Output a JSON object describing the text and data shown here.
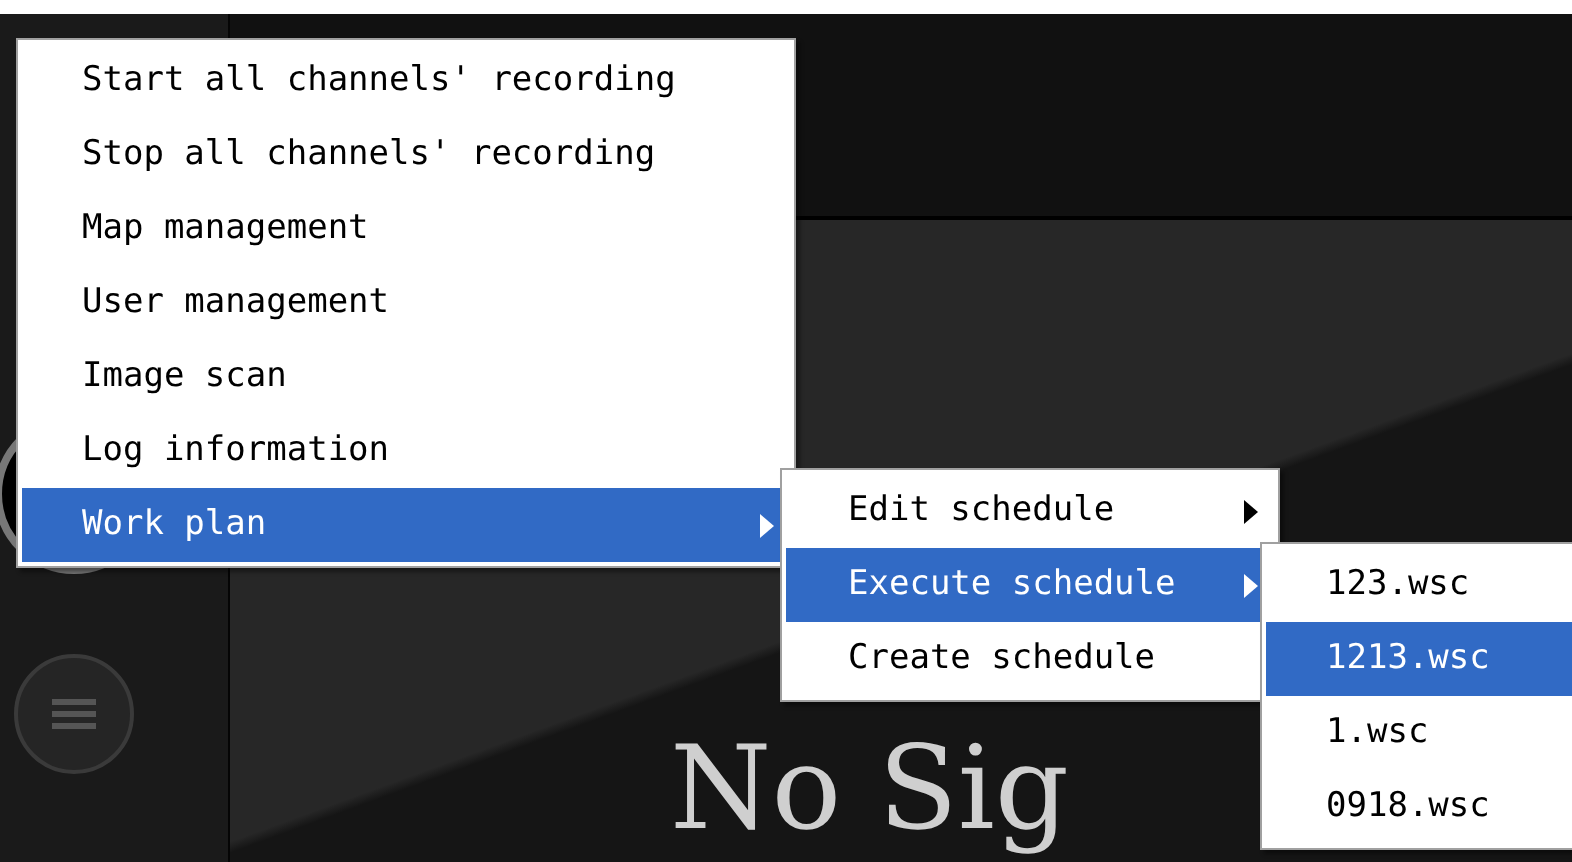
{
  "background": {
    "no_signal_text": "No Sig"
  },
  "menu": {
    "items": [
      {
        "label": "Start all channels' recording",
        "selected": false,
        "has_submenu": false
      },
      {
        "label": "Stop all channels' recording",
        "selected": false,
        "has_submenu": false
      },
      {
        "label": "Map management",
        "selected": false,
        "has_submenu": false
      },
      {
        "label": "User management",
        "selected": false,
        "has_submenu": false
      },
      {
        "label": "Image scan",
        "selected": false,
        "has_submenu": false
      },
      {
        "label": "Log information",
        "selected": false,
        "has_submenu": false
      },
      {
        "label": "Work plan",
        "selected": true,
        "has_submenu": true
      }
    ]
  },
  "schedule_menu": {
    "items": [
      {
        "label": "Edit schedule",
        "selected": false,
        "has_submenu": true
      },
      {
        "label": "Execute schedule",
        "selected": true,
        "has_submenu": true
      },
      {
        "label": "Create schedule",
        "selected": false,
        "has_submenu": false
      }
    ]
  },
  "file_menu": {
    "items": [
      {
        "label": "123.wsc",
        "selected": false,
        "has_submenu": false
      },
      {
        "label": "1213.wsc",
        "selected": true,
        "has_submenu": false
      },
      {
        "label": "1.wsc",
        "selected": false,
        "has_submenu": false
      },
      {
        "label": "0918.wsc",
        "selected": false,
        "has_submenu": false
      }
    ]
  }
}
